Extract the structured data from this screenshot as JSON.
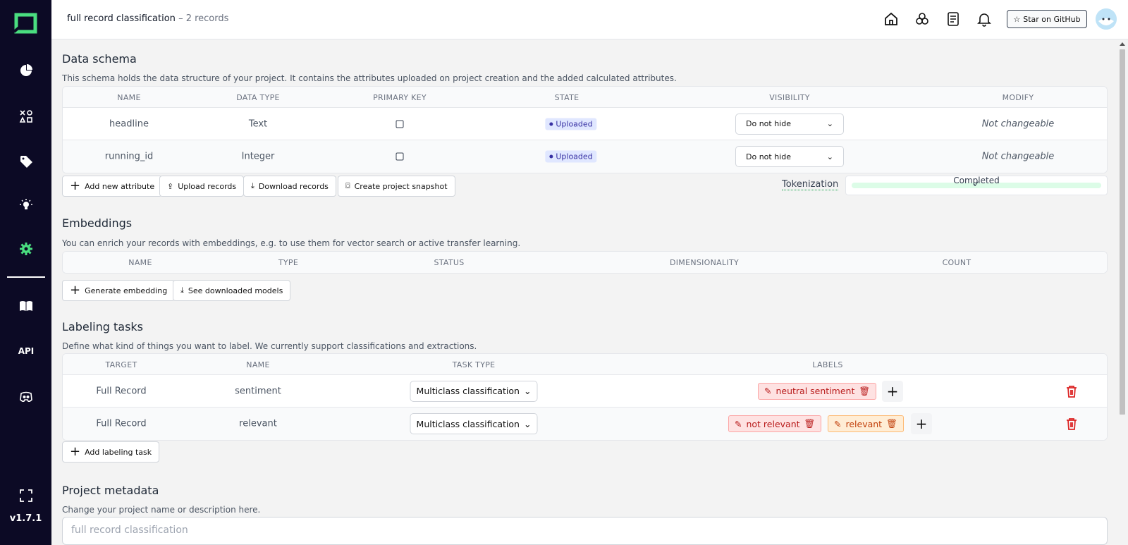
{
  "app": {
    "version": "v1.7.1",
    "api_label": "API"
  },
  "header": {
    "project_name": "full record classification",
    "record_count": "2 records",
    "github_label": "Star on GitHub"
  },
  "schema": {
    "title": "Data schema",
    "description": "This schema holds the data structure of your project. It contains the attributes uploaded on project creation and the added calculated attributes.",
    "columns": [
      "NAME",
      "DATA TYPE",
      "PRIMARY KEY",
      "STATE",
      "VISIBILITY",
      "MODIFY"
    ],
    "rows": [
      {
        "name": "headline",
        "type": "Text",
        "state": "Uploaded",
        "visibility": "Do not hide",
        "modify": "Not changeable"
      },
      {
        "name": "running_id",
        "type": "Integer",
        "state": "Uploaded",
        "visibility": "Do not hide",
        "modify": "Not changeable"
      }
    ],
    "buttons": {
      "add_attribute": "Add new attribute",
      "upload": "Upload records",
      "download": "Download records",
      "snapshot": "Create project snapshot"
    },
    "tokenization_label": "Tokenization",
    "tokenization_status": "Completed",
    "tokenization_progress": 1.0
  },
  "embeddings": {
    "title": "Embeddings",
    "description": "You can enrich your records with embeddings, e.g. to use them for vector search or active transfer learning.",
    "columns": [
      "NAME",
      "TYPE",
      "STATUS",
      "DIMENSIONALITY",
      "COUNT"
    ],
    "buttons": {
      "generate": "Generate embedding",
      "models": "See downloaded models"
    }
  },
  "labeling": {
    "title": "Labeling tasks",
    "description": "Define what kind of things you want to label. We currently support classifications and extractions.",
    "columns": [
      "TARGET",
      "NAME",
      "TASK TYPE",
      "LABELS"
    ],
    "rows": [
      {
        "target": "Full Record",
        "name": "sentiment",
        "task_type": "Multiclass classification",
        "labels": [
          "neutral sentiment"
        ]
      },
      {
        "target": "Full Record",
        "name": "relevant",
        "task_type": "Multiclass classification",
        "labels": [
          "not relevant",
          "relevant"
        ]
      }
    ],
    "add_button": "Add labeling task"
  },
  "metadata": {
    "title": "Project metadata",
    "description": "Change your project name or description here.",
    "name_placeholder": "full record classification"
  },
  "colors": {
    "sidebar": "#0c0a25",
    "accent": "#4ade80",
    "danger": "#dc2626"
  }
}
